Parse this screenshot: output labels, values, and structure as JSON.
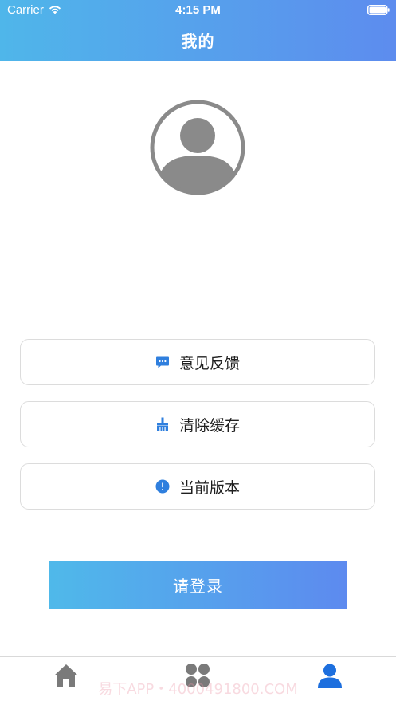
{
  "status_bar": {
    "carrier": "Carrier",
    "time": "4:15 PM"
  },
  "header": {
    "title": "我的",
    "gradient": [
      "#4fb6ea",
      "#5d8cee"
    ]
  },
  "menu": [
    {
      "label": "意见反馈",
      "icon": "feedback-icon"
    },
    {
      "label": "清除缓存",
      "icon": "broom-icon"
    },
    {
      "label": "当前版本",
      "icon": "info-icon"
    }
  ],
  "login_button": {
    "label": "请登录"
  },
  "tabbar": {
    "items": [
      {
        "icon": "home-icon"
      },
      {
        "icon": "grid-icon"
      },
      {
        "icon": "profile-icon",
        "active": true
      }
    ]
  },
  "watermark": "易下APP・4000491800.COM",
  "colors": {
    "accent": "#2f7fde",
    "inactive": "#7a7a7a",
    "avatar_gray": "#8a8a8a"
  }
}
